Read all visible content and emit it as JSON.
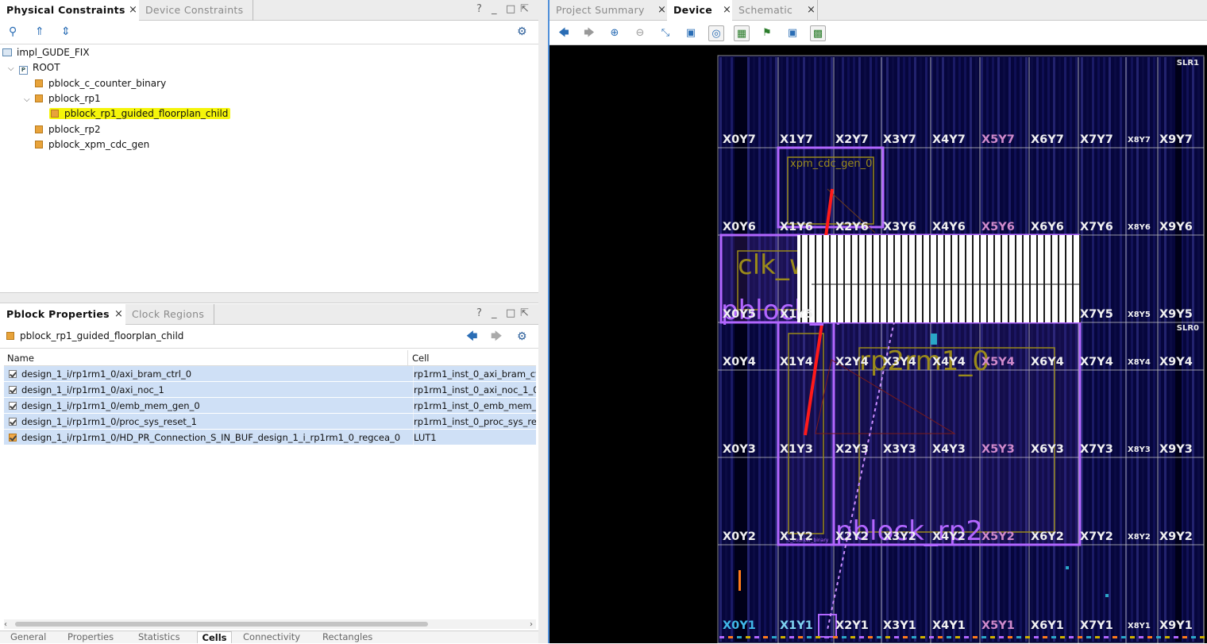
{
  "physical_constraints": {
    "tabs": [
      {
        "label": "Physical Constraints",
        "active": true
      },
      {
        "label": "Device Constraints",
        "active": false
      }
    ],
    "window_controls": [
      "?",
      "_",
      "□",
      "⇱"
    ],
    "tree": {
      "root_design": "impl_GUDE_FIX",
      "root_label": "ROOT",
      "items": [
        {
          "label": "pblock_c_counter_binary",
          "level": 2,
          "highlighted": false
        },
        {
          "label": "pblock_rp1",
          "level": 2,
          "expanded": true,
          "highlighted": false
        },
        {
          "label": "pblock_rp1_guided_floorplan_child",
          "level": 3,
          "highlighted": true
        },
        {
          "label": "pblock_rp2",
          "level": 2,
          "highlighted": false
        },
        {
          "label": "pblock_xpm_cdc_gen",
          "level": 2,
          "highlighted": false
        }
      ]
    }
  },
  "pblock_properties": {
    "tabs": [
      {
        "label": "Pblock Properties",
        "active": true
      },
      {
        "label": "Clock Regions",
        "active": false
      }
    ],
    "selected_pblock": "pblock_rp1_guided_floorplan_child",
    "columns": [
      "Name",
      "Cell"
    ],
    "rows": [
      {
        "name": "design_1_i/rp1rm1_0/axi_bram_ctrl_0",
        "cell": "rp1rm1_inst_0_axi_bram_ct",
        "orange": false
      },
      {
        "name": "design_1_i/rp1rm1_0/axi_noc_1",
        "cell": "rp1rm1_inst_0_axi_noc_1_0",
        "orange": false
      },
      {
        "name": "design_1_i/rp1rm1_0/emb_mem_gen_0",
        "cell": "rp1rm1_inst_0_emb_mem_g",
        "orange": false
      },
      {
        "name": "design_1_i/rp1rm1_0/proc_sys_reset_1",
        "cell": "rp1rm1_inst_0_proc_sys_re",
        "orange": false
      },
      {
        "name": "design_1_i/rp1rm1_0/HD_PR_Connection_S_IN_BUF_design_1_i_rp1rm1_0_regcea_0",
        "cell": "LUT1",
        "orange": true
      }
    ],
    "bottom_tabs": [
      "General",
      "Properties",
      "Statistics",
      "Cells",
      "Connectivity",
      "Rectangles"
    ],
    "active_bottom_tab": "Cells"
  },
  "device_view": {
    "tabs": [
      {
        "label": "Project Summary",
        "active": false
      },
      {
        "label": "Device",
        "active": true
      },
      {
        "label": "Schematic",
        "active": false
      }
    ],
    "slr_labels": [
      "SLR1",
      "SLR0"
    ],
    "clock_rows": [
      {
        "row": 7,
        "labels": [
          "X0Y7",
          "X1Y7",
          "X2Y7",
          "X3Y7",
          "X4Y7",
          "X5Y7",
          "X6Y7",
          "X7Y7",
          "X8Y7",
          "X9Y7"
        ]
      },
      {
        "row": 6,
        "labels": [
          "X0Y6",
          "X1Y6",
          "X2Y6",
          "X3Y6",
          "X4Y6",
          "X5Y6",
          "X6Y6",
          "X7Y6",
          "X8Y6",
          "X9Y6"
        ]
      },
      {
        "row": 5,
        "labels": [
          "X0Y5",
          "X1Y5",
          "",
          "",
          "",
          "",
          "",
          "X7Y5",
          "X8Y5",
          "X9Y5"
        ]
      },
      {
        "row": 4,
        "labels": [
          "X0Y4",
          "X1Y4",
          "X2Y4",
          "X3Y4",
          "X4Y4",
          "X5Y4",
          "X6Y4",
          "X7Y4",
          "X8Y4",
          "X9Y4"
        ]
      },
      {
        "row": 3,
        "labels": [
          "X0Y3",
          "X1Y3",
          "X2Y3",
          "X3Y3",
          "X4Y3",
          "X5Y3",
          "X6Y3",
          "X7Y3",
          "X8Y3",
          "X9Y3"
        ]
      },
      {
        "row": 2,
        "labels": [
          "X0Y2",
          "X1Y2",
          "X2Y2",
          "X3Y2",
          "X4Y2",
          "X5Y2",
          "X6Y2",
          "X7Y2",
          "X8Y2",
          "X9Y2"
        ]
      },
      {
        "row": 1,
        "labels": [
          "X0Y1",
          "X1Y1",
          "X2Y1",
          "X3Y1",
          "X4Y1",
          "X5Y1",
          "X6Y1",
          "X7Y1",
          "X8Y1",
          "X9Y1"
        ]
      }
    ],
    "overlay_labels": {
      "xpm": "xpm_cdc_gen_0",
      "clk": "clk_wizard_0",
      "pblock_rp1": "pblock_rp1",
      "rp2": "rp2rm1_0",
      "pblock_rp2": "pblock_rp2",
      "counter": "c_counter_binary"
    },
    "colors": {
      "pblock_violet": "#b266ff",
      "cell_olive": "#9a8a1a",
      "net_red": "#ff1a1a",
      "background": "#0a0a3a"
    }
  }
}
